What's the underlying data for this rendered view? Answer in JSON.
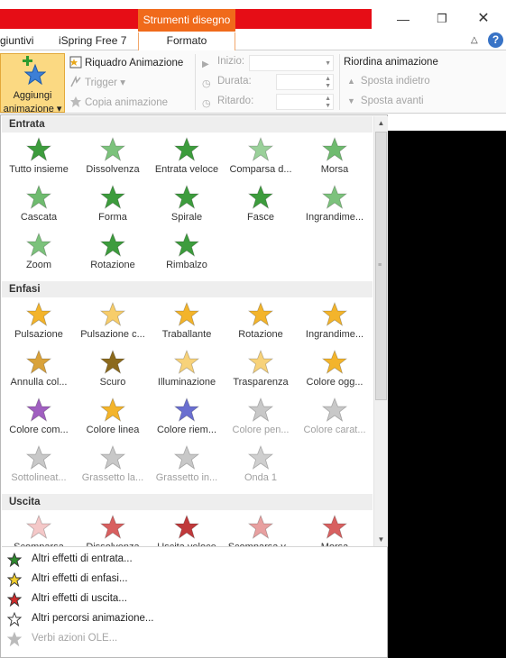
{
  "titlebar": {
    "tools_context": "Strumenti disegno",
    "minimize_icon": "minimize-icon",
    "restore_icon": "restore-icon",
    "close_icon": "close-icon"
  },
  "tabs": [
    "giuntivi",
    "iSpring Free 7",
    "Formato"
  ],
  "ribbon": {
    "add_animation": {
      "line1": "Aggiungi",
      "line2": "animazione ▾"
    },
    "animation_pane": "Riquadro Animazione",
    "trigger": "Trigger ▾",
    "copy_animation": "Copia animazione",
    "start_label": "Inizio:",
    "start_value": "",
    "duration_label": "Durata:",
    "duration_value": "",
    "delay_label": "Ritardo:",
    "delay_value": "",
    "reorder_title": "Riordina animazione",
    "move_earlier": "Sposta indietro",
    "move_later": "Sposta avanti"
  },
  "gallery": {
    "sections": [
      {
        "title": "Entrata",
        "items": [
          {
            "label": "Tutto insieme",
            "color": "#3d9c3d",
            "enabled": true
          },
          {
            "label": "Dissolvenza",
            "color": "#7cc27c",
            "enabled": true
          },
          {
            "label": "Entrata veloce",
            "color": "#3d9c3d",
            "enabled": true
          },
          {
            "label": "Comparsa d...",
            "color": "#9ad09a",
            "enabled": true
          },
          {
            "label": "Morsa",
            "color": "#6fbb6f",
            "enabled": true
          },
          {
            "label": "Cascata",
            "color": "#6fbb6f",
            "enabled": true
          },
          {
            "label": "Forma",
            "color": "#3d9c3d",
            "enabled": true
          },
          {
            "label": "Spirale",
            "color": "#3d9c3d",
            "enabled": true
          },
          {
            "label": "Fasce",
            "color": "#3d9c3d",
            "enabled": true
          },
          {
            "label": "Ingrandime...",
            "color": "#7cc27c",
            "enabled": true
          },
          {
            "label": "Zoom",
            "color": "#7cc27c",
            "enabled": true
          },
          {
            "label": "Rotazione",
            "color": "#3d9c3d",
            "enabled": true
          },
          {
            "label": "Rimbalzo",
            "color": "#3d9c3d",
            "enabled": true
          }
        ]
      },
      {
        "title": "Enfasi",
        "items": [
          {
            "label": "Pulsazione",
            "color": "#f3b42b",
            "enabled": true
          },
          {
            "label": "Pulsazione c...",
            "color": "#f7cd6a",
            "enabled": true
          },
          {
            "label": "Traballante",
            "color": "#f3b42b",
            "enabled": true
          },
          {
            "label": "Rotazione",
            "color": "#f3b42b",
            "enabled": true
          },
          {
            "label": "Ingrandime...",
            "color": "#f3b42b",
            "enabled": true
          },
          {
            "label": "Annulla col...",
            "color": "#d9a23a",
            "enabled": true
          },
          {
            "label": "Scuro",
            "color": "#8c6a1d",
            "enabled": true
          },
          {
            "label": "Illuminazione",
            "color": "#f7d27a",
            "enabled": true
          },
          {
            "label": "Trasparenza",
            "color": "#f7d27a",
            "enabled": true
          },
          {
            "label": "Colore ogg...",
            "color": "#f3b42b",
            "enabled": true
          },
          {
            "label": "Colore com...",
            "color": "#a05fc0",
            "enabled": true
          },
          {
            "label": "Colore linea",
            "color": "#f3b42b",
            "enabled": true
          },
          {
            "label": "Colore riem...",
            "color": "#6a6fd0",
            "enabled": true
          },
          {
            "label": "Colore pen...",
            "color": "#c8c8c8",
            "enabled": false
          },
          {
            "label": "Colore carat...",
            "color": "#c8c8c8",
            "enabled": false
          },
          {
            "label": "Sottolineat...",
            "color": "#c8c8c8",
            "enabled": false
          },
          {
            "label": "Grassetto la...",
            "color": "#c8c8c8",
            "enabled": false
          },
          {
            "label": "Grassetto in...",
            "color": "#c8c8c8",
            "enabled": false
          },
          {
            "label": "Onda 1",
            "color": "#cfcfcf",
            "enabled": false
          }
        ]
      },
      {
        "title": "Uscita",
        "items": [
          {
            "label": "Scomparsa",
            "color": "#f4c8c8",
            "enabled": true
          },
          {
            "label": "Dissolvenza",
            "color": "#d86060",
            "enabled": true
          },
          {
            "label": "Uscita veloce",
            "color": "#c0393b",
            "enabled": true
          },
          {
            "label": "Scomparsa v...",
            "color": "#e8a0a0",
            "enabled": true
          },
          {
            "label": "Morsa",
            "color": "#d86060",
            "enabled": true
          }
        ]
      }
    ]
  },
  "more": [
    {
      "label": "Altri effetti di entrata...",
      "color": "#2e8b2e",
      "enabled": true
    },
    {
      "label": "Altri effetti di enfasi...",
      "color": "#f3cf2b",
      "enabled": true
    },
    {
      "label": "Altri effetti di uscita...",
      "color": "#d02b2b",
      "enabled": true
    },
    {
      "label": "Altri percorsi animazione...",
      "color": "#ffffff",
      "enabled": true
    },
    {
      "label": "Verbi azioni OLE...",
      "color": "#bbbbbb",
      "enabled": false
    }
  ]
}
